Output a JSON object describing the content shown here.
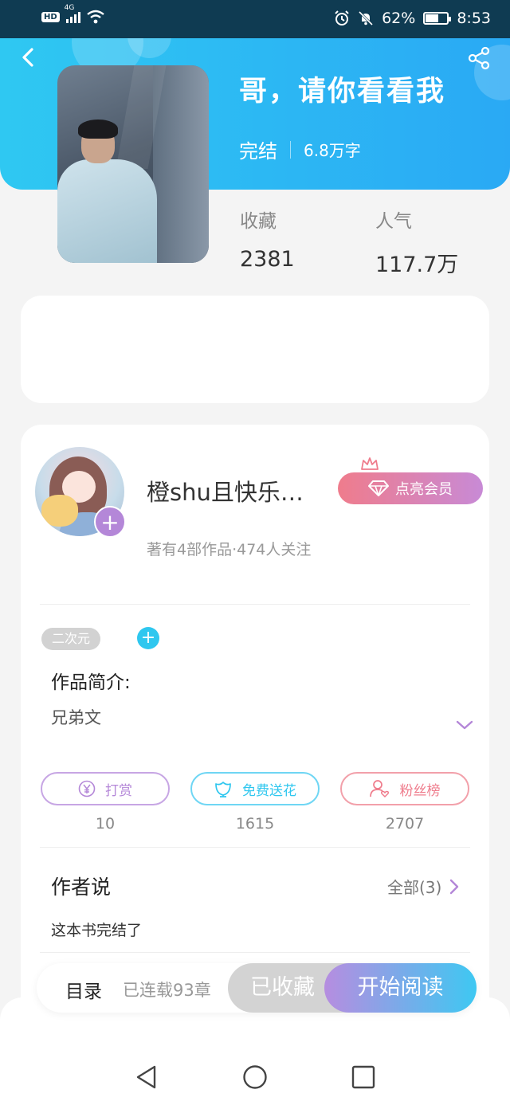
{
  "status_bar": {
    "hd_label": "HD",
    "network_label": "4G",
    "battery_percent": "62%",
    "battery_level": 0.62,
    "time": "8:53",
    "icons": [
      "hd-icon",
      "signal-icon",
      "wifi-icon",
      "alarm-icon",
      "bell-muted-icon",
      "battery-icon"
    ]
  },
  "book": {
    "title": "哥，请你看看我",
    "status": "完结",
    "word_count": "6.8万字",
    "favorites_label": "收藏",
    "favorites_value": "2381",
    "popularity_label": "人气",
    "popularity_value": "117.7万"
  },
  "author": {
    "name": "橙shu且快乐…",
    "stats": "著有4部作品·474人关注",
    "vip_label": "点亮会员",
    "follow_symbol": "+"
  },
  "tags": {
    "items": [
      "二次元"
    ],
    "add_symbol": "+"
  },
  "intro": {
    "title": "作品简介:",
    "text": "兄弟文"
  },
  "actions": [
    {
      "label": "打赏",
      "count": "10",
      "icon": "yen-coin-icon",
      "color": "#b487d8"
    },
    {
      "label": "免费送花",
      "count": "1615",
      "icon": "flower-icon",
      "color": "#2fc7ef"
    },
    {
      "label": "粉丝榜",
      "count": "2707",
      "icon": "fan-user-icon",
      "color": "#ef7c8c"
    }
  ],
  "author_says": {
    "title": "作者说",
    "see_all": "全部(3)",
    "note": "这本书完结了"
  },
  "bottom_bar": {
    "toc": "目录",
    "chapters": "已连载93章",
    "collected": "已收藏",
    "read": "开始阅读"
  },
  "colors": {
    "header_start": "#2fc8f2",
    "header_end": "#2aa9f4",
    "accent_purple": "#b487d8",
    "accent_cyan": "#2fc7ef",
    "accent_pink": "#ef7c8c"
  }
}
